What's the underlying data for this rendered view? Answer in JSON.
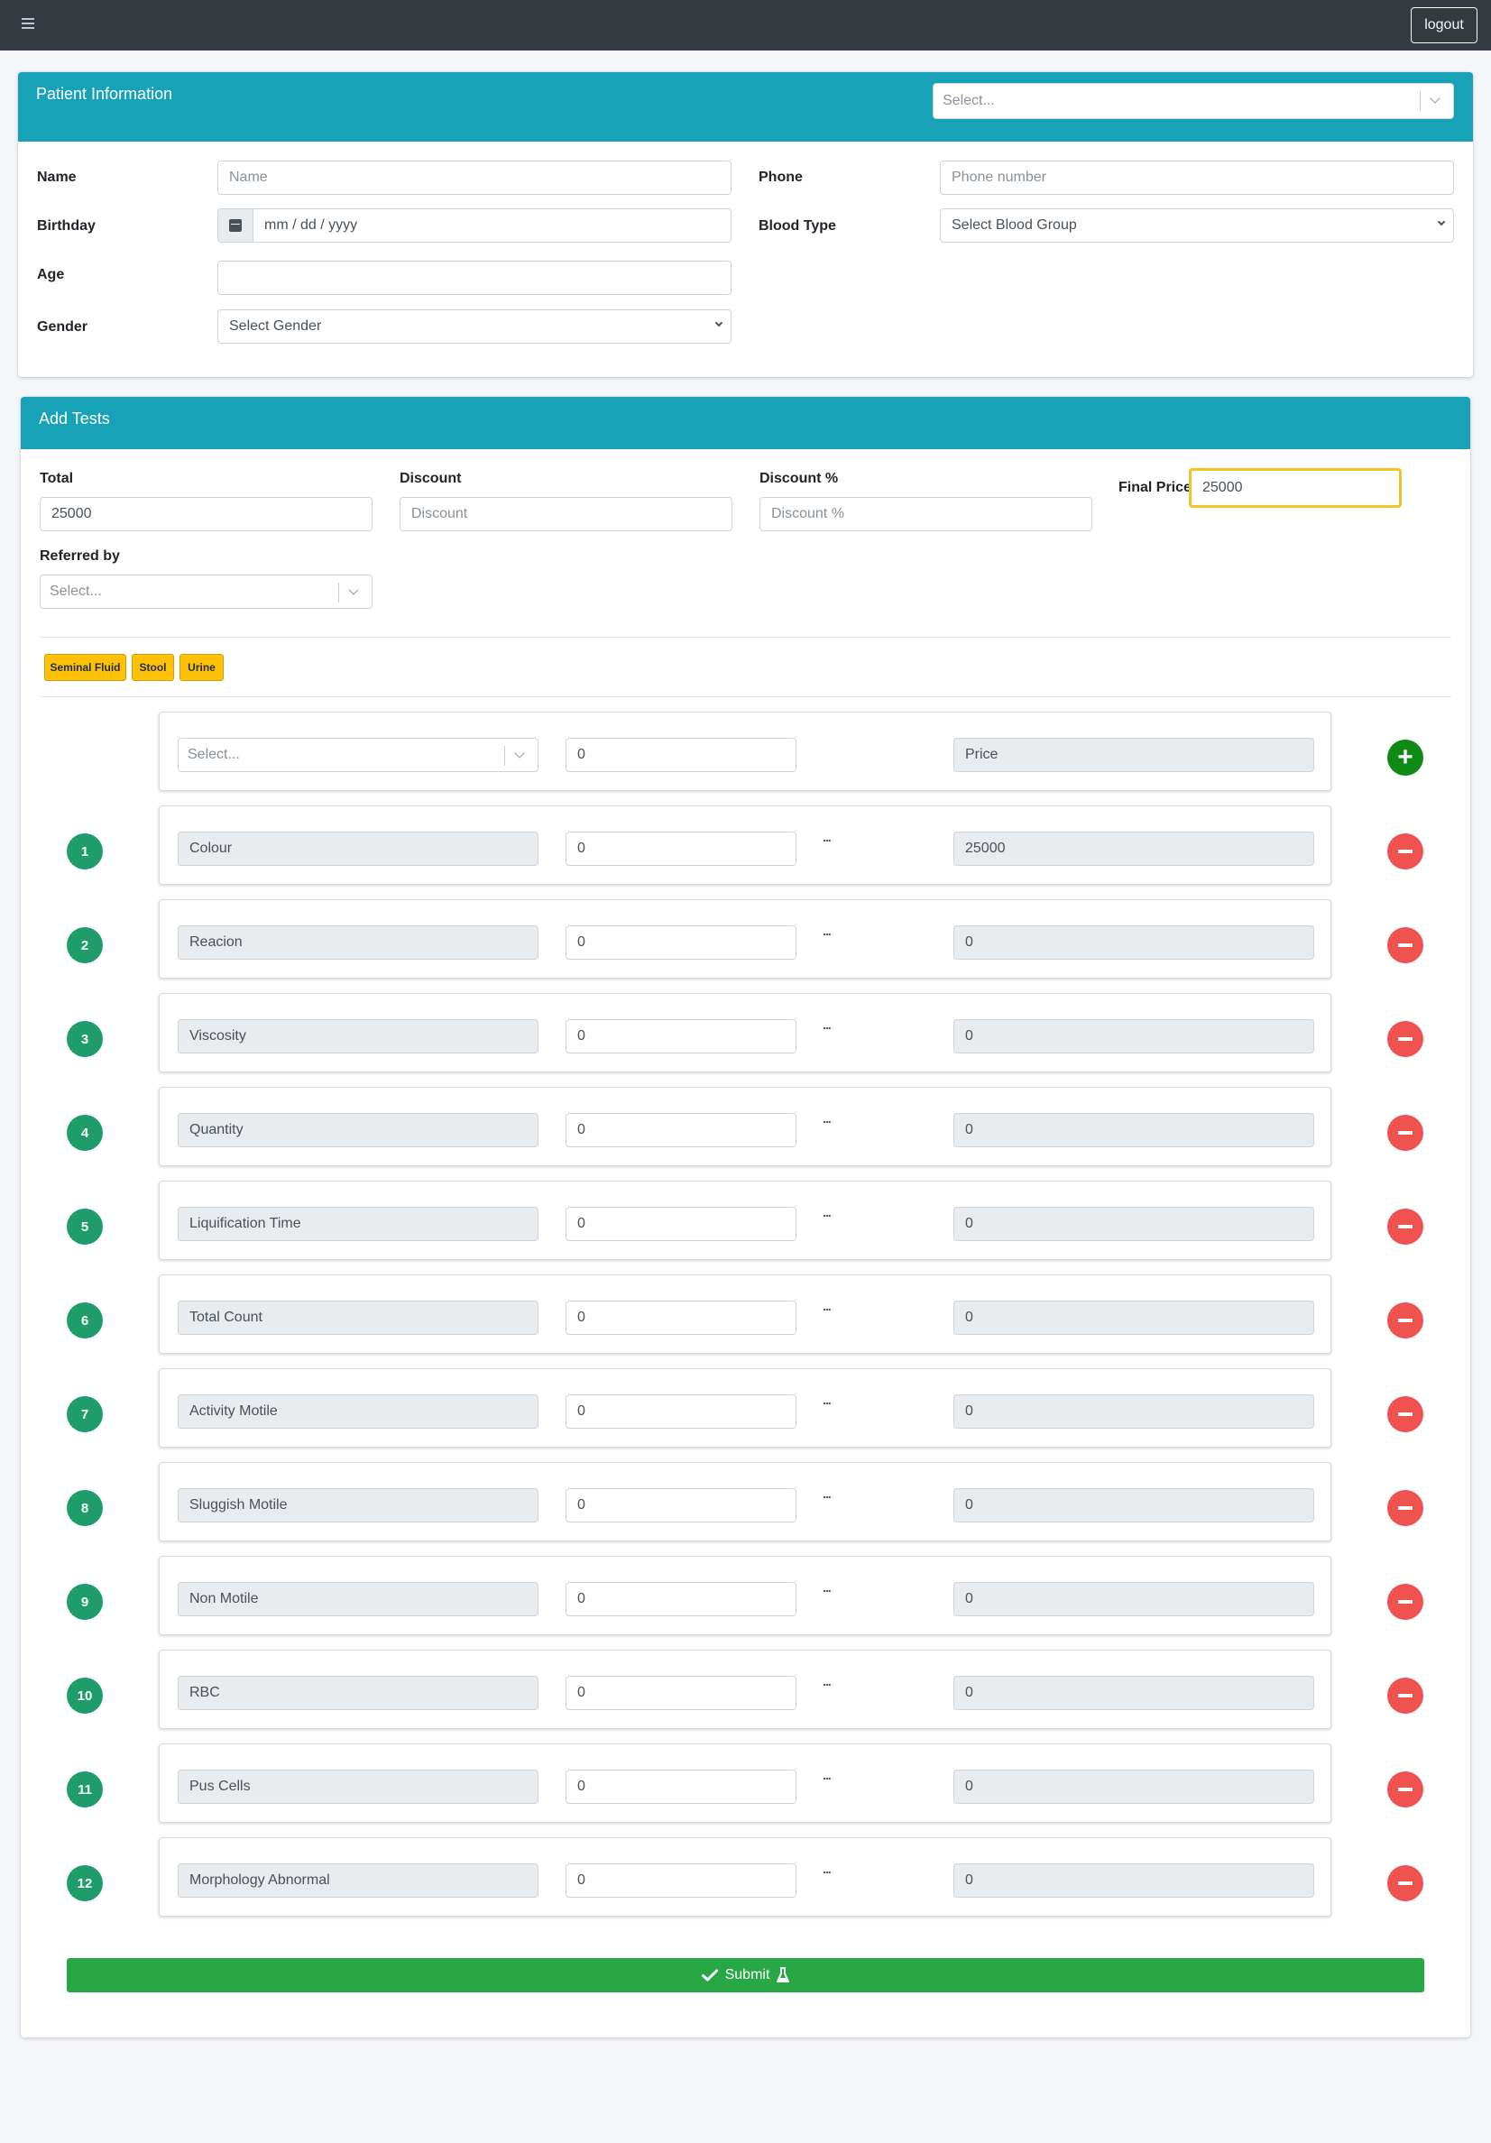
{
  "navbar": {
    "menu_icon": "hamburger-icon",
    "logout_label": "logout"
  },
  "patient": {
    "header_title": "Patient Information",
    "header_select_placeholder": "Select...",
    "name_label": "Name",
    "name_placeholder": "Name",
    "phone_label": "Phone",
    "phone_placeholder": "Phone number",
    "birthday_label": "Birthday",
    "birthday_placeholder": "mm / dd / yyyy",
    "blood_type_label": "Blood Type",
    "blood_type_value": "Select Blood Group",
    "age_label": "Age",
    "age_value": "",
    "gender_label": "Gender",
    "gender_value": "Select Gender"
  },
  "tests": {
    "header_title": "Add Tests",
    "total_label": "Total",
    "total_value": "25000",
    "discount_label": "Discount",
    "discount_placeholder": "Discount",
    "discount_pct_label": "Discount %",
    "discount_pct_placeholder": "Discount %",
    "final_price_label": "Final Price",
    "final_price_value": "25000",
    "referred_label": "Referred by",
    "referred_placeholder": "Select...",
    "categories": [
      "Seminal Fluid",
      "Stool",
      "Urine"
    ],
    "new_row": {
      "select_placeholder": "Select...",
      "qty": "0",
      "price_placeholder": "Price"
    },
    "rows": [
      {
        "num": "1",
        "name": "Colour",
        "qty": "0",
        "dots": "...",
        "price": "25000"
      },
      {
        "num": "2",
        "name": "Reacion",
        "qty": "0",
        "dots": "...",
        "price": "0"
      },
      {
        "num": "3",
        "name": "Viscosity",
        "qty": "0",
        "dots": "...",
        "price": "0"
      },
      {
        "num": "4",
        "name": "Quantity",
        "qty": "0",
        "dots": "...",
        "price": "0"
      },
      {
        "num": "5",
        "name": "Liquification Time",
        "qty": "0",
        "dots": "...",
        "price": "0"
      },
      {
        "num": "6",
        "name": "Total Count",
        "qty": "0",
        "dots": "...",
        "price": "0"
      },
      {
        "num": "7",
        "name": "Activity Motile",
        "qty": "0",
        "dots": "...",
        "price": "0"
      },
      {
        "num": "8",
        "name": "Sluggish Motile",
        "qty": "0",
        "dots": "...",
        "price": "0"
      },
      {
        "num": "9",
        "name": "Non Motile",
        "qty": "0",
        "dots": "...",
        "price": "0"
      },
      {
        "num": "10",
        "name": "RBC",
        "qty": "0",
        "dots": "...",
        "price": "0"
      },
      {
        "num": "11",
        "name": "Pus Cells",
        "qty": "0",
        "dots": "...",
        "price": "0"
      },
      {
        "num": "12",
        "name": "Morphology Abnormal",
        "qty": "0",
        "dots": "...",
        "price": "0"
      }
    ],
    "submit_label": "Submit"
  },
  "colors": {
    "header": "#17a2b8",
    "submit": "#28a745",
    "badge": "#1e9d6a",
    "remove": "#ef5350",
    "add": "#0f8a15",
    "tag": "#ffc107",
    "highlight": "#f4c22b"
  }
}
